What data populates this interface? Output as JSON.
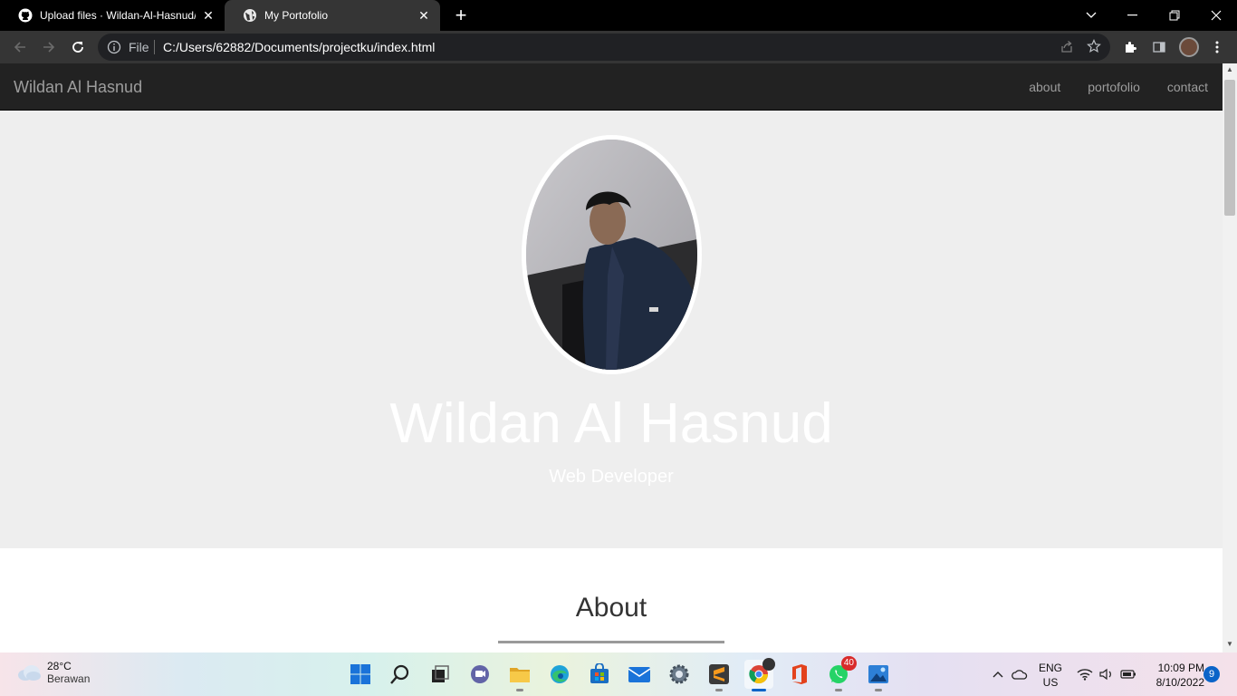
{
  "browser": {
    "tabs": [
      {
        "title": "Upload files · Wildan-Al-Hasnud/",
        "favicon": "github-icon"
      },
      {
        "title": "My Portofolio",
        "favicon": "globe-icon"
      }
    ],
    "address": {
      "scheme_label": "File",
      "url": "C:/Users/62882/Documents/projectku/index.html"
    }
  },
  "site": {
    "brand": "Wildan Al Hasnud",
    "nav": [
      "about",
      "portofolio",
      "contact"
    ],
    "hero": {
      "name": "Wildan Al Hasnud",
      "role": "Web Developer"
    },
    "about": {
      "heading": "About"
    },
    "colors": {
      "navbar": "#222222",
      "hero_bg": "#eeeeee",
      "nav_text": "#9d9d9d"
    }
  },
  "taskbar": {
    "weather": {
      "temp": "28°C",
      "condition": "Berawan"
    },
    "apps": [
      {
        "name": "start-icon"
      },
      {
        "name": "search-icon"
      },
      {
        "name": "task-view-icon"
      },
      {
        "name": "teams-chat-icon"
      },
      {
        "name": "file-explorer-icon"
      },
      {
        "name": "edge-icon"
      },
      {
        "name": "store-icon"
      },
      {
        "name": "mail-icon"
      },
      {
        "name": "settings-icon"
      },
      {
        "name": "sublime-text-icon"
      },
      {
        "name": "chrome-icon"
      },
      {
        "name": "office-icon"
      },
      {
        "name": "whatsapp-icon",
        "badge": "40"
      },
      {
        "name": "photos-icon"
      }
    ],
    "language": {
      "line1": "ENG",
      "line2": "US"
    },
    "clock": {
      "time": "10:09 PM",
      "date": "8/10/2022"
    },
    "notification_count": "9"
  }
}
